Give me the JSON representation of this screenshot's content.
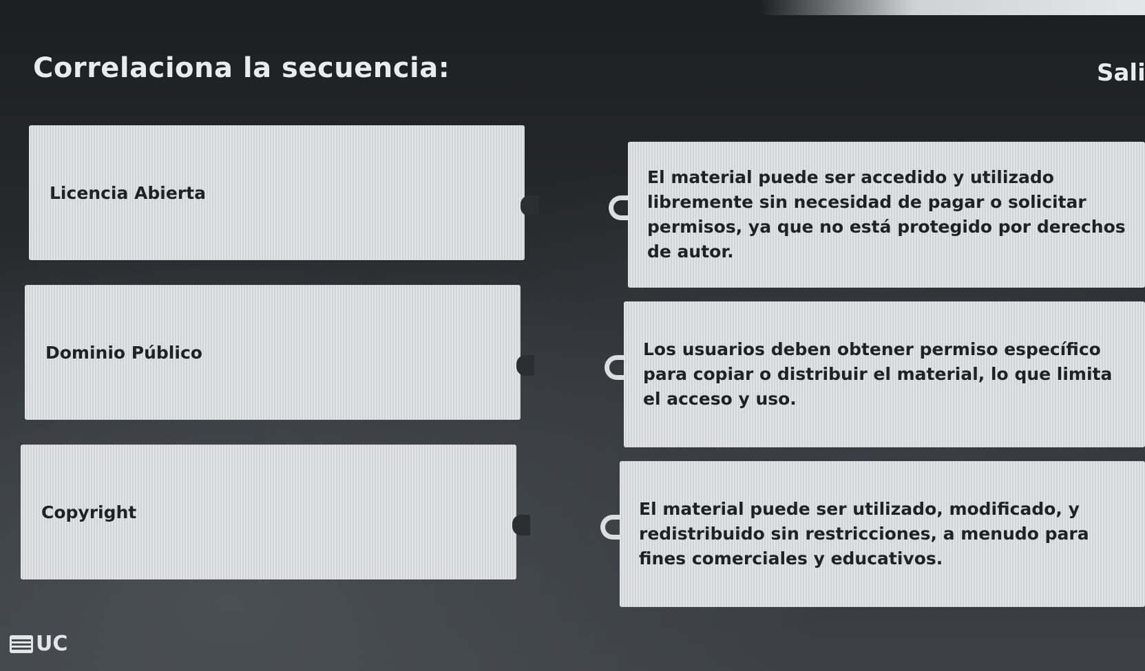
{
  "header": {
    "title": "Correlaciona la secuencia:",
    "exit_label": "Salir"
  },
  "terms": [
    {
      "label": "Licencia Abierta"
    },
    {
      "label": "Dominio Público"
    },
    {
      "label": "Copyright"
    }
  ],
  "definitions": [
    {
      "text": "El material puede ser accedido y utilizado libremente sin necesidad de pagar o solicitar permisos, ya que no está protegido por derechos de autor."
    },
    {
      "text": "Los usuarios deben obtener permiso específico para copiar o distribuir el material, lo que limita el acceso y uso."
    },
    {
      "text": "El material puede ser utilizado, modificado, y redistribuido sin restricciones, a menudo para fines comerciales y educativos."
    }
  ],
  "footer": {
    "logo_text": "UC"
  }
}
